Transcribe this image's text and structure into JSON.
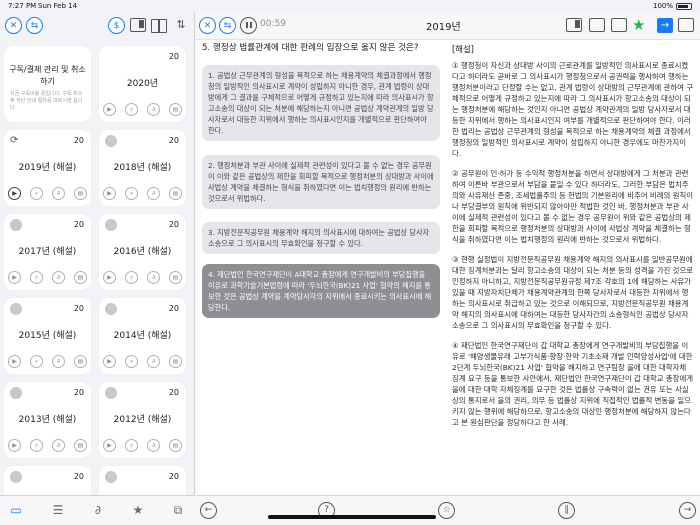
{
  "status": {
    "time": "7:27 PM",
    "date": "Sun Feb 14",
    "battery": "100%"
  },
  "colors": {
    "accent": "#1a7cf2",
    "selected_option": "#8e8e93",
    "option_bg": "#e5e5ea",
    "star": "#2bb24c"
  },
  "left_toolbar": {
    "icons": [
      "close-icon",
      "switch-icon",
      "dollar-icon",
      "split-view-icon",
      "book-icon",
      "sort-icon"
    ]
  },
  "cards": [
    {
      "title": "구독/결제 관리 및 취소하기",
      "count": "",
      "desc": "지금 구독이용 중입니다. 구독 취소 후 하단 안내 절차를 따르시면 됩니다."
    },
    {
      "title": "2020년",
      "count": "20"
    },
    {
      "title": "2019년 (해설)",
      "count": "20"
    },
    {
      "title": "2018년 (해설)",
      "count": "20"
    },
    {
      "title": "2017년 (해설)",
      "count": "20"
    },
    {
      "title": "2016년 (해설)",
      "count": "20"
    },
    {
      "title": "2015년 (해설)",
      "count": "20"
    },
    {
      "title": "2014년 (해설)",
      "count": "20"
    },
    {
      "title": "2013년 (해설)",
      "count": "20"
    },
    {
      "title": "2012년 (해설)",
      "count": "20"
    },
    {
      "title": "",
      "count": "20"
    },
    {
      "title": "",
      "count": "20"
    }
  ],
  "left_tabs": [
    "folder-icon",
    "list-icon",
    "paperclip-icon",
    "star-icon",
    "add-copy-icon"
  ],
  "main_toolbar": {
    "timer": "00:59",
    "title": "2019년"
  },
  "question": {
    "text": "5. 행정상 법률관계에 대한 판례의 입장으로 옳지 않은 것은?",
    "options": [
      "1. 공법상 근무관계의 형성을 목적으로 하는 채용계약의 체결과정에서 행정청의 일방적인 의사표시로 계약이 성립하지 아니한 경우, 관계 법령이 상대방에게 그 결과를 구체적으로 어떻게 규정하고 있는지에 따라 의사표시가 항고소송의 대상이 되는 처분에 해당하는지 아니면 공법상 계약관계의 일방 당사자로서 대등한 지위에서 행하는 의사표시인지를 개별적으로 판단하여야 한다.",
      "2. 행정처분과 부관 사이에 실제적 관련성이 있다고 볼 수 없는 경우 공무원이 이와 같은 공법상의 제한을 회피할 목적으로 행정처분의 상대방과 사이에 사법상 계약을 체결하는 형식을 취하였다면 이는 법치행정의 원리에 반하는 것으로서 위법하다.",
      "3. 지방전문직공무원 채용계약 해지의 의사표시에 대하여는 공법상 당사자소송으로 그 의사표시의 무효확인을 청구할 수 있다.",
      "4. 재단법인 한국연구재단이 A대학교 총장에게 연구개발비의 부당집행을 이유로 과학기술기본법령에 따라 '두뇌한국(BK)21 사업' 협약의 해지를 통보한 것은 공법상 계약을 계약당사자의 지위에서 종료시키는 의사표시에 해당한다."
    ],
    "selected": 3
  },
  "explanation": {
    "heading": "[해설]",
    "paragraphs": [
      "① 행정청이 자신과 상대방 사이의 근로관계를 일방적인 의사표시로 종료시켰다고 하더라도 곧바로 그 의사표시가 행정청으로서 공권력을 행사하여 행하는 행정처분이라고 단정할 수는 없고, 관계 법령이 상대방의 근무관계에 관하여 구체적으로 어떻게 규정하고 있는지에 따라 그 의사표시가 항고소송의 대상이 되는 행정처분에 해당하는 것인지 아니면 공법상 계약관계의 일방 당사자로서 대등한 지위에서 행하는 의사표시인지 여부를 개별적으로 판단하여야 한다. 이러한 법리는 공법상 근무관계의 형성을 목적으로 하는 채용계약의 체결 과정에서 행정청의 일방적인 의사표시로 계약이 성립하지 아니한 경우에도 마찬가지이다.",
      "② 공무원이 인·허가 등 수익적 행정처분을 하면서 상대방에게 그 처분과 관련하여 이른바 부관으로서 부담을 붙일 수 있다 하더라도, 그러한 부담은 법치주의와 사유재산 존중, 조세법률주의 등 헌법의 기본원리에 비추어 비례의 원칙이나 부당결부의 원칙에 위반되지 않아야만 적법한 것인 바, 행정처분과 부관 사이에 실제적 관련성이 있다고 볼 수 없는 경우 공무원이 위와 같은 공법상의 제한을 회피할 목적으로 행정처분의 상대방과 사이에 사법상 계약을 체결하는 형식을 취하였다면 이는 법치행정의 원리에 반하는 것으로서 위법하다.",
      "③ 현행 실정법이 지방전문직공무원 채용계약 해지의 의사표시를 일반공무원에 대한 징계처분과는 달리 항고소송의 대상이 되는 처분 등의 성격을 가진 것으로 인정하지 아니하고, 지방전문직공무원규정 제7조 각호의 1에 해당하는 사유가 있을 때 지방자치단체가 채용계약관계의 한쪽 당사자로서 대등한 지위에서 행하는 의사표시로 취급하고 있는 것으로 이해되므로, 지방전문직공무원 채용계약 해지의 의사표시에 대하여는 대등한 당사자간의 소송형식인 공법상 당사자소송으로 그 의사표시의 무효확인을 청구할 수 있다.",
      "④ 재단법인 한국연구재단이 갑 대학교 총장에게 연구개발비의 부당집행을 이유로 '해양생물유래 고부가식품·향장·한약 기초소재 개발 인력양성사업'에 대한 2단계 두뇌한국(BK)21 사업' 협약을 해지하고 연구팀장 을에 대한 대학자체 징계 요구 등을 통보한 사안에서, 재단법인 한국연구재단이 갑 대학교 총장에게 을에 대한 대학 자체징계를 요구한 것은 법률상 구속력이 없는 권유 또는 사실상의 통지로서 을의 권리, 의무 등 법률상 지위에 직접적인 법률적 변동을 일으키지 않는 행위에 해당하므로, 항고소송의 대상인 행정처분에 해당하지 않는다고 본 원심판단을 정당하다고 한 사례."
    ]
  }
}
